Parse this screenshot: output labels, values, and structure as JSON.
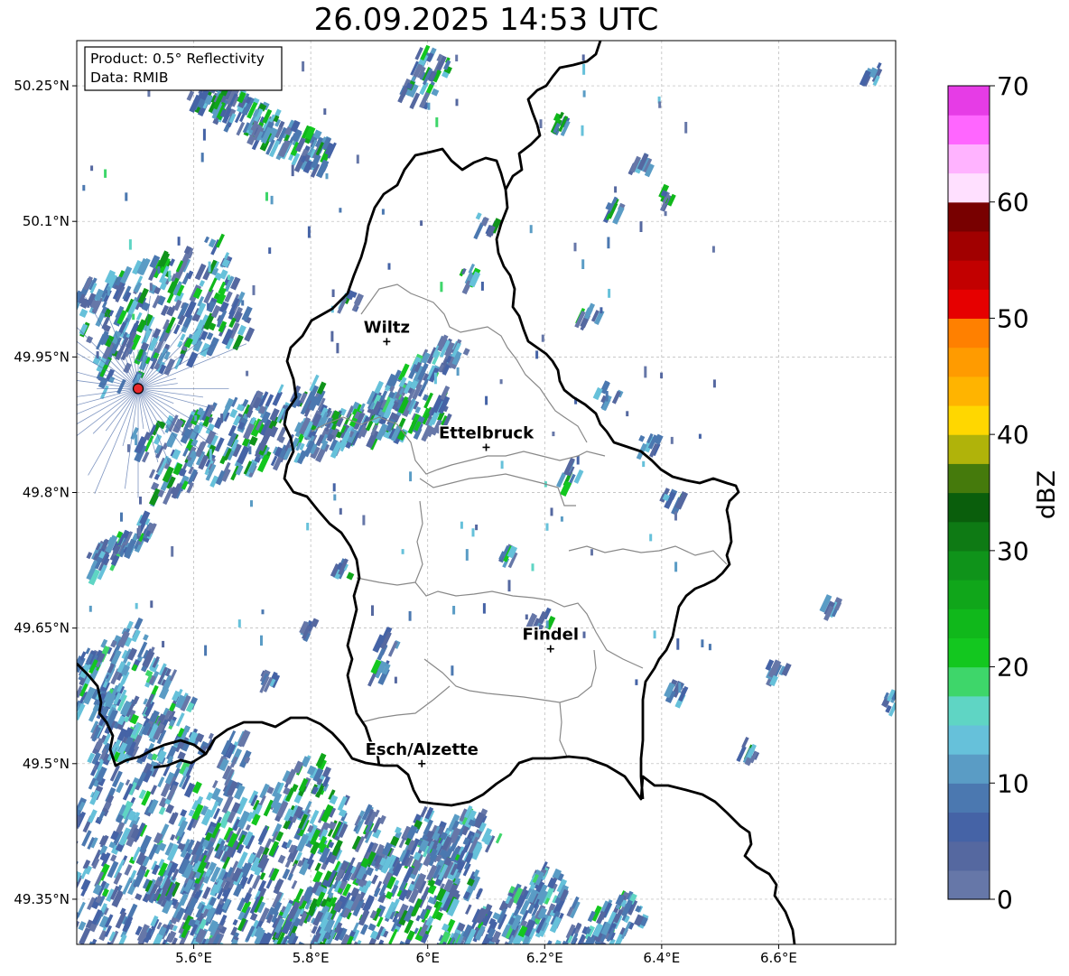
{
  "title": "26.09.2025 14:53 UTC",
  "info_box": {
    "line1": "Product: 0.5° Reflectivity",
    "line2": "Data: RMIB"
  },
  "map": {
    "lon_range": [
      5.4,
      6.8
    ],
    "lat_range": [
      49.3,
      50.3
    ],
    "x_ticks": [
      "5.6°E",
      "5.8°E",
      "6°E",
      "6.2°E",
      "6.4°E",
      "6.6°E"
    ],
    "y_ticks": [
      "50.25°N",
      "50.1°N",
      "49.95°N",
      "49.8°N",
      "49.65°N",
      "49.5°N",
      "49.35°N"
    ],
    "grid": "dashed, on",
    "radar_site": {
      "lon": 5.505,
      "lat": 49.915,
      "color": "#e8282a"
    },
    "cities": [
      {
        "name": "Wiltz",
        "lon": 5.93,
        "lat": 49.967
      },
      {
        "name": "Ettelbruck",
        "lon": 6.1,
        "lat": 49.85
      },
      {
        "name": "Findel",
        "lon": 6.21,
        "lat": 49.627
      },
      {
        "name": "Esch/Alzette",
        "lon": 5.99,
        "lat": 49.5
      }
    ]
  },
  "colorbar": {
    "label": "dBZ",
    "ticks": [
      "0",
      "10",
      "20",
      "30",
      "40",
      "50",
      "60",
      "70"
    ],
    "range": [
      0,
      70
    ],
    "step": 2.5,
    "colors": [
      "#6677a8",
      "#5568a0",
      "#4563a6",
      "#4b78b0",
      "#5a9cc5",
      "#66c1da",
      "#5fd5c4",
      "#3ed66a",
      "#13c71f",
      "#10b81b",
      "#10a61a",
      "#0f931a",
      "#0e7a14",
      "#0a5e0c",
      "#457a0c",
      "#b0b30a",
      "#ffd700",
      "#ffb400",
      "#ff9b00",
      "#ff8000",
      "#e60000",
      "#c20000",
      "#a10000",
      "#780000",
      "#ffe0ff",
      "#ffb3ff",
      "#ff66ff",
      "#e63ce6"
    ]
  }
}
